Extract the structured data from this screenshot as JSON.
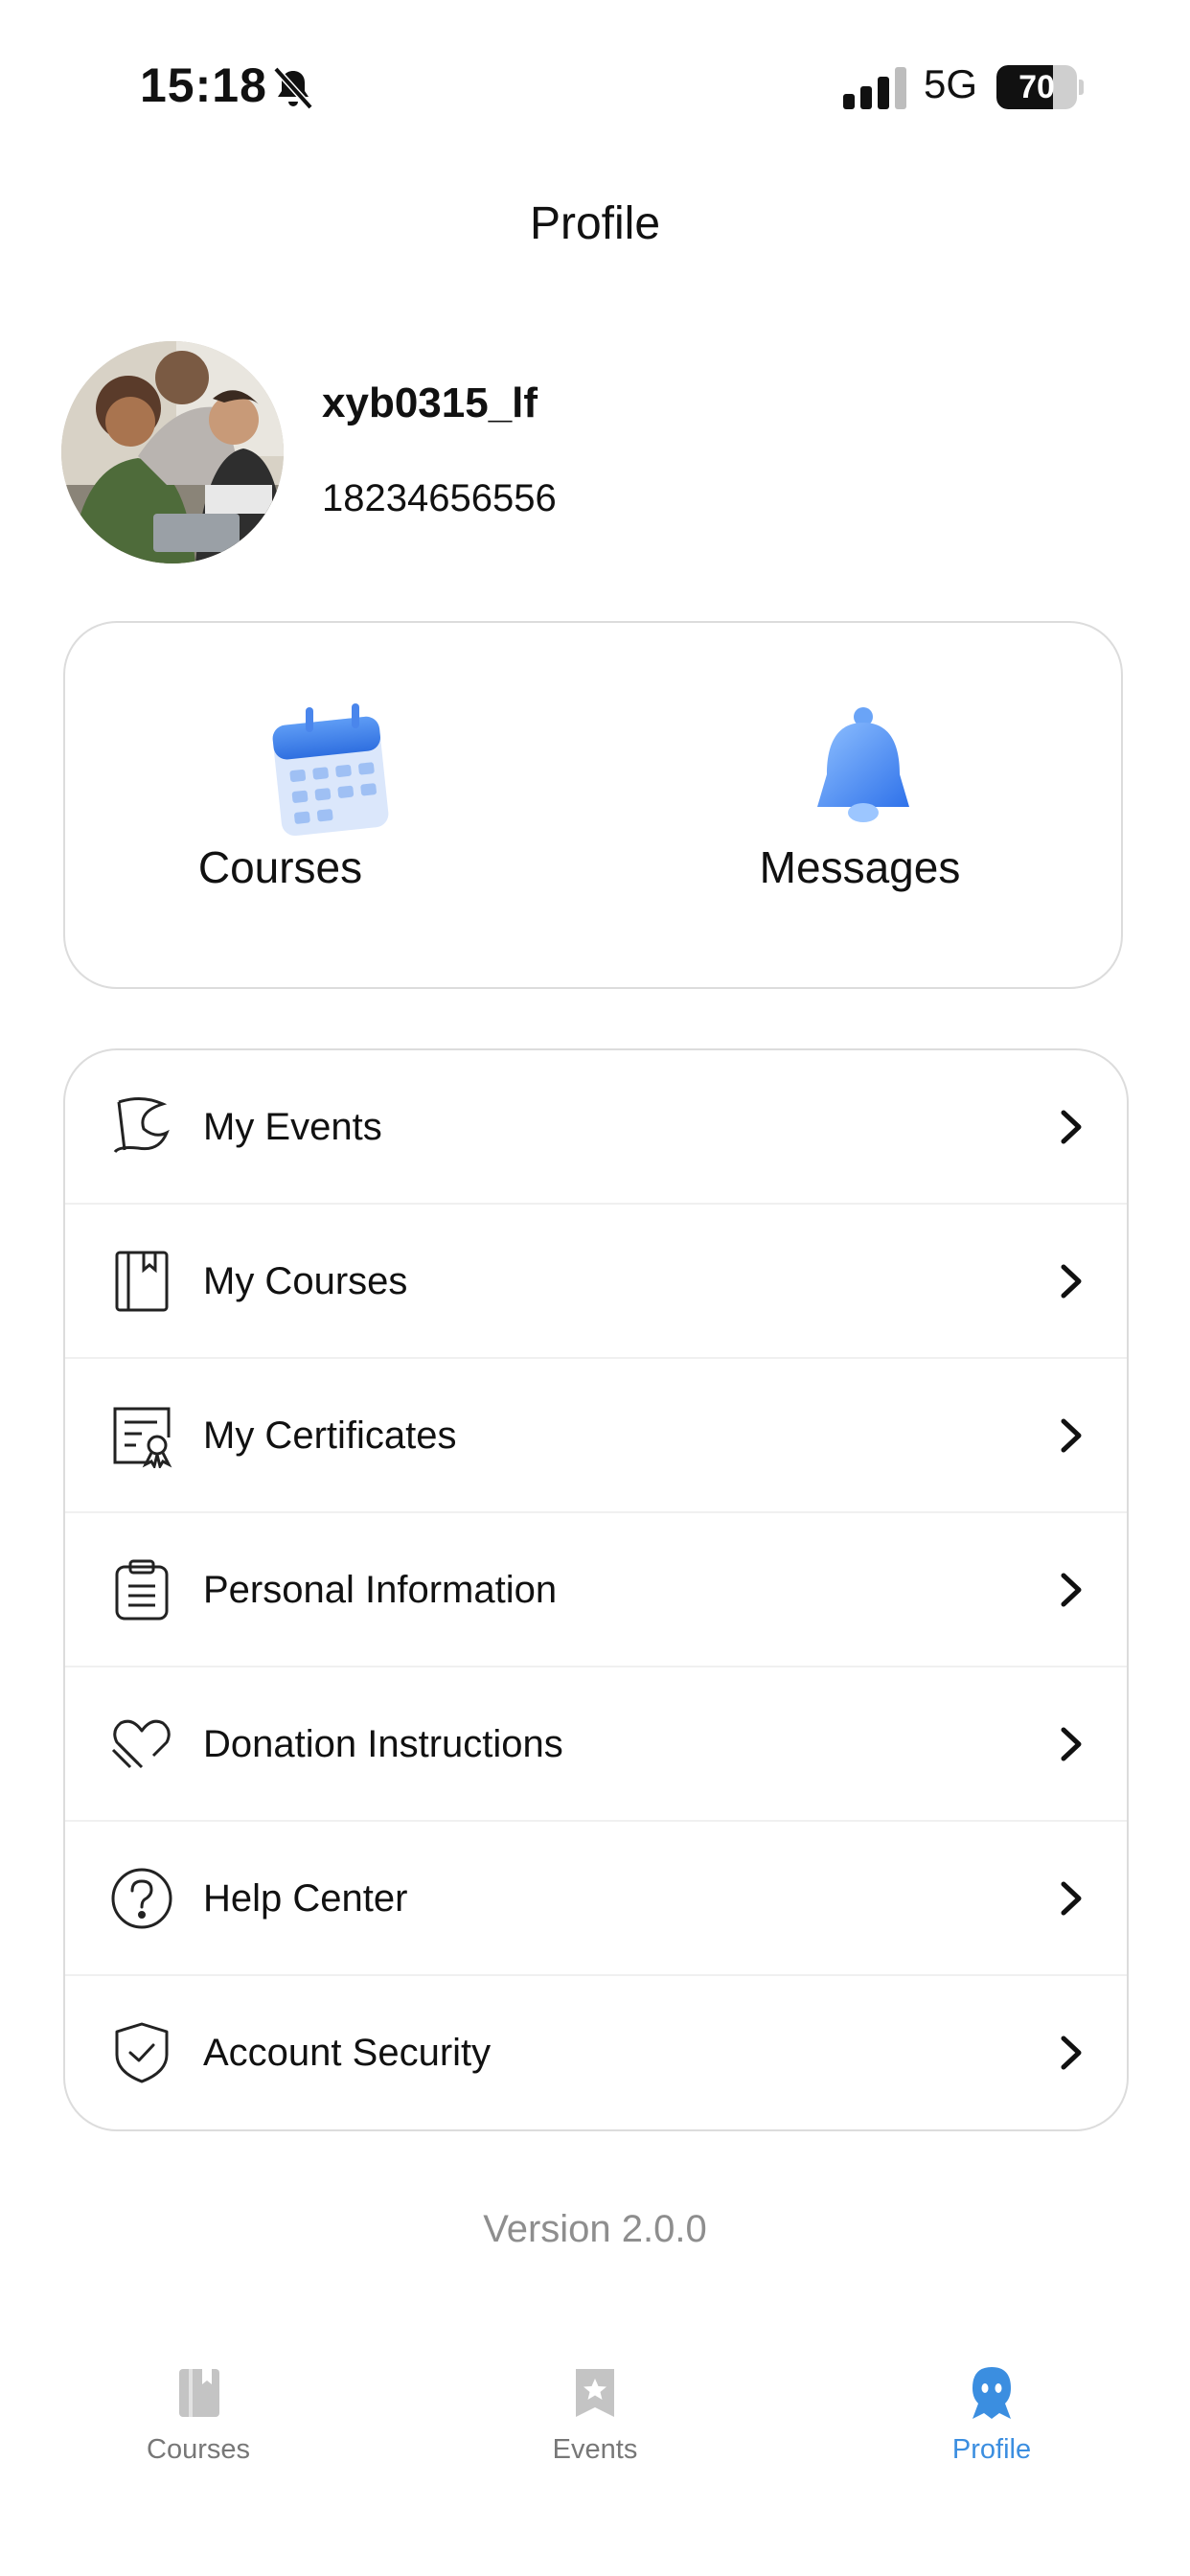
{
  "status_bar": {
    "time": "15:18",
    "network": "5G",
    "battery_level": "70"
  },
  "page_title": "Profile",
  "user": {
    "username": "xyb0315_lf",
    "phone": "18234656556"
  },
  "quick_actions": [
    {
      "label": "Courses",
      "icon": "calendar-icon"
    },
    {
      "label": "Messages",
      "icon": "bell-icon"
    }
  ],
  "menu": [
    {
      "label": "My Events",
      "icon": "flag-icon"
    },
    {
      "label": "My Courses",
      "icon": "book-icon"
    },
    {
      "label": "My Certificates",
      "icon": "certificate-icon"
    },
    {
      "label": "Personal Information",
      "icon": "clipboard-icon"
    },
    {
      "label": "Donation Instructions",
      "icon": "heart-hand-icon"
    },
    {
      "label": "Help Center",
      "icon": "question-icon"
    },
    {
      "label": "Account Security",
      "icon": "shield-check-icon"
    }
  ],
  "version": "Version 2.0.0",
  "tabs": [
    {
      "label": "Courses",
      "icon": "book-icon",
      "active": false
    },
    {
      "label": "Events",
      "icon": "star-bookmark-icon",
      "active": false
    },
    {
      "label": "Profile",
      "icon": "person-icon",
      "active": true
    }
  ],
  "colors": {
    "accent": "#3b8ee0",
    "inactive_tab": "#c4c4c4",
    "border": "#dcdcdc"
  }
}
